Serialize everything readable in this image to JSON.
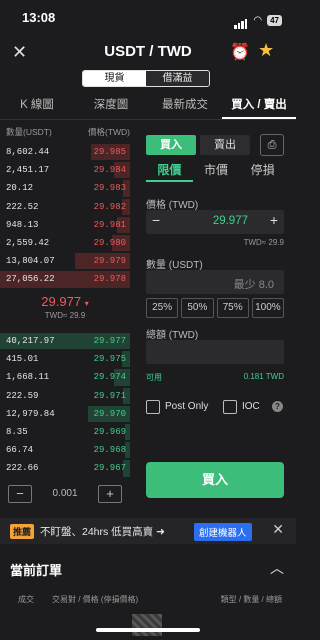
{
  "status_bar": {
    "time": "13:08",
    "battery": "47"
  },
  "header": {
    "pair": "USDT / TWD",
    "seg": [
      "現貨",
      "借滿益"
    ]
  },
  "tabs": [
    "K 線圖",
    "深度圖",
    "最新成交",
    "買入 / 賣出"
  ],
  "orderbook": {
    "qty_header": "數量(USDT)",
    "price_header": "價格(TWD)",
    "asks": [
      {
        "q": "8,602.44",
        "p": "29.985",
        "d": 0.3
      },
      {
        "q": "2,451.17",
        "p": "29.984",
        "d": 0.12
      },
      {
        "q": "20.12",
        "p": "29.983",
        "d": 0.05
      },
      {
        "q": "222.52",
        "p": "29.982",
        "d": 0.06
      },
      {
        "q": "948.13",
        "p": "29.981",
        "d": 0.1
      },
      {
        "q": "2,559.42",
        "p": "29.980",
        "d": 0.14
      },
      {
        "q": "13,804.07",
        "p": "29.979",
        "d": 0.42
      },
      {
        "q": "27,056.22",
        "p": "29.978",
        "d": 1.0
      }
    ],
    "mid_price": "29.977",
    "mid_twd": "TWD≈ 29.9",
    "bids": [
      {
        "q": "40,217.97",
        "p": "29.977",
        "d": 1.0
      },
      {
        "q": "415.01",
        "p": "29.975",
        "d": 0.06
      },
      {
        "q": "1,668.11",
        "p": "29.974",
        "d": 0.12
      },
      {
        "q": "222.59",
        "p": "29.971",
        "d": 0.05
      },
      {
        "q": "12,979.84",
        "p": "29.970",
        "d": 0.32
      },
      {
        "q": "8.35",
        "p": "29.969",
        "d": 0.04
      },
      {
        "q": "66.74",
        "p": "29.968",
        "d": 0.04
      },
      {
        "q": "222.66",
        "p": "29.967",
        "d": 0.05
      }
    ],
    "step_minus": "−",
    "step_value": "0.001",
    "step_plus": "+"
  },
  "trade": {
    "buy_tab": "買入",
    "sell_tab": "賣出",
    "order_types": [
      "限價",
      "市價",
      "停損"
    ],
    "price_label": "價格 (TWD)",
    "price_minus": "−",
    "price_value": "29.977",
    "price_plus": "+",
    "price_hint": "TWD≈ 29.9",
    "qty_label": "數量 (USDT)",
    "qty_placeholder": "最少 8.0",
    "percents": [
      "25%",
      "50%",
      "75%",
      "100%"
    ],
    "total_label": "總額 (TWD)",
    "avail_label": "可用",
    "avail_value": "0.181 TWD",
    "post_only": "Post Only",
    "ioc": "IOC",
    "help": "?",
    "buy_button": "買入"
  },
  "promo": {
    "tag": "推薦",
    "text": "不盯盤、24hrs 低買高賣 ➜",
    "cta": "創建機器人",
    "close": "✕"
  },
  "orders": {
    "title": "當前訂單",
    "cols": [
      "成交",
      "交易對 / 價格 (停損價格)",
      "類型 / 數量 / 總額"
    ]
  }
}
